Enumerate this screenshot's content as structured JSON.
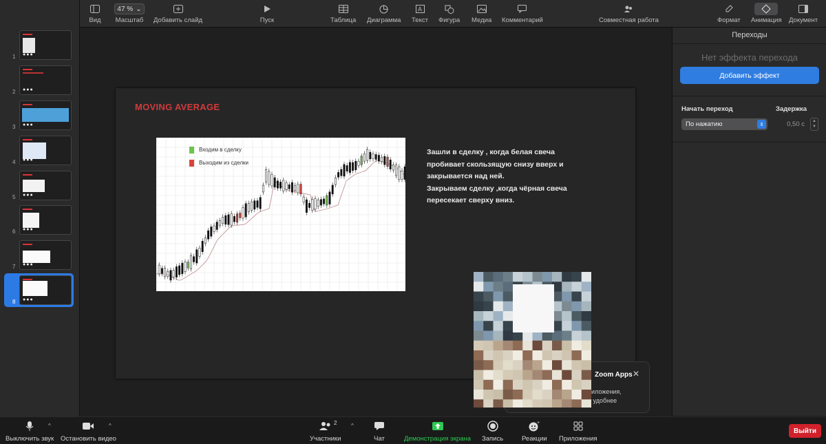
{
  "toolbar": {
    "view": "Вид",
    "zoom_value": "47 %",
    "zoom": "Масштаб",
    "add_slide": "Добавить слайд",
    "play": "Пуск",
    "table": "Таблица",
    "chart": "Диаграмма",
    "text": "Текст",
    "shape": "Фигура",
    "media": "Медиа",
    "comment": "Комментарий",
    "collaborate": "Совместная работа",
    "format": "Формат",
    "animate": "Анимация",
    "document": "Документ"
  },
  "navigator": {
    "slides": [
      {
        "number": "1"
      },
      {
        "number": "2"
      },
      {
        "number": "3"
      },
      {
        "number": "4"
      },
      {
        "number": "5"
      },
      {
        "number": "6"
      },
      {
        "number": "7"
      },
      {
        "number": "8"
      }
    ],
    "selected": "8",
    "dots": "●●●"
  },
  "slide": {
    "title": "MOVING AVERAGE",
    "legend_enter": "Входим в сделку",
    "legend_exit": "Выходим из сделки",
    "text_lines": [
      "Зашли в сделку , когда белая свеча",
      "пробивает скользящую снизу вверх и",
      "закрывается над ней.",
      "Закрываем сделку ,когда чёрная свеча",
      "пересекает сверху вниз."
    ],
    "colors": {
      "title": "#d23b3b",
      "enter": "#6fc24a",
      "exit": "#d8443a"
    }
  },
  "zoom_popup": {
    "title": "Zoom Apps",
    "line1": "риложения,",
    "line2": "е удобнее"
  },
  "inspector": {
    "title": "Переходы",
    "no_effect": "Нет эффекта перехода",
    "add_effect": "Добавить эффект",
    "start_label": "Начать переход",
    "start_value": "По нажатию",
    "delay_label": "Задержка",
    "delay_value": "0,50 с"
  },
  "zoombar": {
    "mute": "Выключить звук",
    "stop_video": "Остановить видео",
    "participants": "Участники",
    "participants_count": "2",
    "chat": "Чат",
    "share": "Демонстрация экрана",
    "record": "Запись",
    "reactions": "Реакции",
    "apps": "Приложения",
    "leave": "Выйти",
    "share_color": "#2ec852",
    "leave_color": "#d1212b"
  }
}
